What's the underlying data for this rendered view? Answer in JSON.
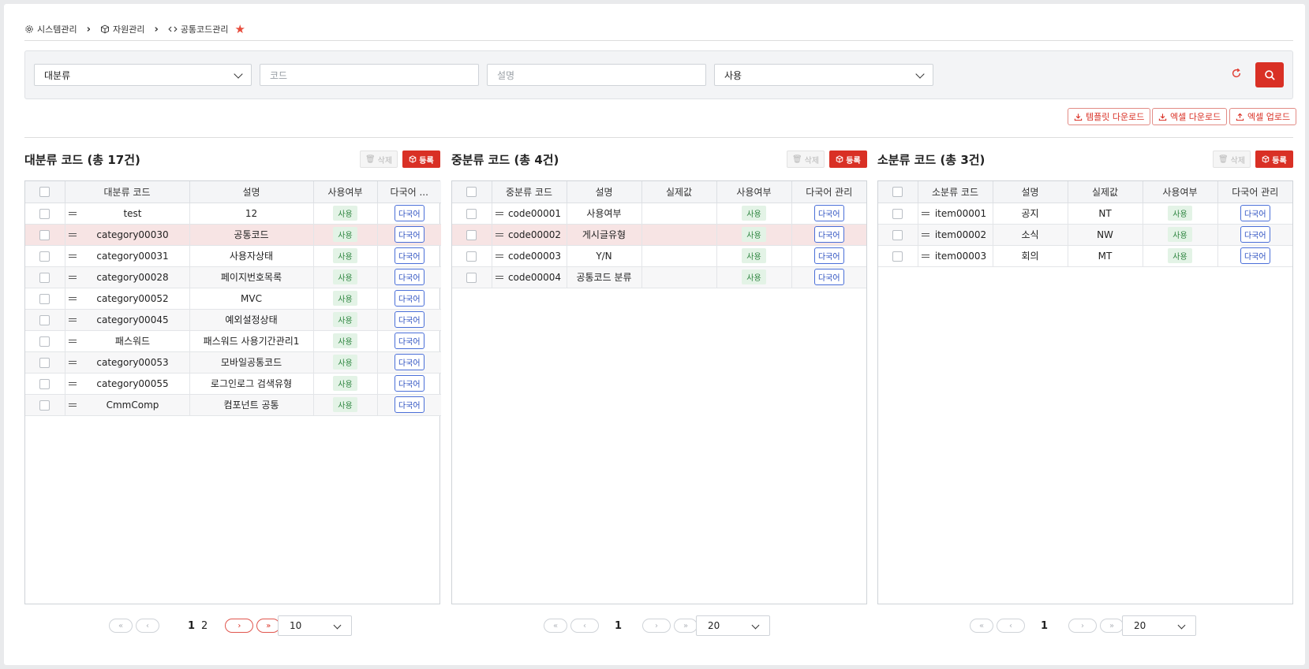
{
  "breadcrumb": {
    "items": [
      "시스템관리",
      "자원관리",
      "공통코드관리"
    ]
  },
  "search": {
    "major_select": "대분류",
    "code_placeholder": "코드",
    "desc_placeholder": "설명",
    "use_select": "사용"
  },
  "actions": {
    "template_download": "템플릿 다운로드",
    "excel_download": "엑셀 다운로드",
    "excel_upload": "엑셀 업로드"
  },
  "common": {
    "delete_label": "삭제",
    "register_label": "등록",
    "use_badge": "사용",
    "lang_button": "다국어"
  },
  "major": {
    "title": "대분류 코드 (총 17건)",
    "headers": [
      "대분류 코드",
      "설명",
      "사용여부",
      "다국어 ..."
    ],
    "rows": [
      {
        "code": "test",
        "desc": "12",
        "use": "사용",
        "lang": "다국어"
      },
      {
        "code": "category00030",
        "desc": "공통코드",
        "use": "사용",
        "lang": "다국어"
      },
      {
        "code": "category00031",
        "desc": "사용자상태",
        "use": "사용",
        "lang": "다국어"
      },
      {
        "code": "category00028",
        "desc": "페이지번호목록",
        "use": "사용",
        "lang": "다국어"
      },
      {
        "code": "category00052",
        "desc": "MVC",
        "use": "사용",
        "lang": "다국어"
      },
      {
        "code": "category00045",
        "desc": "예외설정상태",
        "use": "사용",
        "lang": "다국어"
      },
      {
        "code": "패스워드",
        "desc": "패스워드 사용기간관리1",
        "use": "사용",
        "lang": "다국어"
      },
      {
        "code": "category00053",
        "desc": "모바일공통코드",
        "use": "사용",
        "lang": "다국어"
      },
      {
        "code": "category00055",
        "desc": "로그인로그 검색유형",
        "use": "사용",
        "lang": "다국어"
      },
      {
        "code": "CmmComp",
        "desc": "컴포넌트 공통",
        "use": "사용",
        "lang": "다국어"
      }
    ],
    "pages": [
      "1",
      "2"
    ],
    "page_size": "10"
  },
  "middle": {
    "title": "중분류 코드 (총 4건)",
    "headers": [
      "중분류 코드",
      "설명",
      "실제값",
      "사용여부",
      "다국어 관리"
    ],
    "rows": [
      {
        "code": "code00001",
        "desc": "사용여부",
        "value": "",
        "use": "사용",
        "lang": "다국어"
      },
      {
        "code": "code00002",
        "desc": "게시글유형",
        "value": "",
        "use": "사용",
        "lang": "다국어"
      },
      {
        "code": "code00003",
        "desc": "Y/N",
        "value": "",
        "use": "사용",
        "lang": "다국어"
      },
      {
        "code": "code00004",
        "desc": "공통코드 분류",
        "value": "",
        "use": "사용",
        "lang": "다국어"
      }
    ],
    "pages": [
      "1"
    ],
    "page_size": "20"
  },
  "minor": {
    "title": "소분류 코드 (총 3건)",
    "headers": [
      "소분류 코드",
      "설명",
      "실제값",
      "사용여부",
      "다국어 관리"
    ],
    "rows": [
      {
        "code": "item00001",
        "desc": "공지",
        "value": "NT",
        "use": "사용",
        "lang": "다국어"
      },
      {
        "code": "item00002",
        "desc": "소식",
        "value": "NW",
        "use": "사용",
        "lang": "다국어"
      },
      {
        "code": "item00003",
        "desc": "회의",
        "value": "MT",
        "use": "사용",
        "lang": "다국어"
      }
    ],
    "pages": [
      "1"
    ],
    "page_size": "20"
  }
}
